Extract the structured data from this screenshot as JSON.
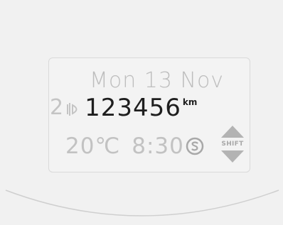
{
  "display": {
    "date": "Mon 13 Nov",
    "trip_gear": "2",
    "odometer": "123456",
    "odometer_unit": "km",
    "temperature": "20℃",
    "time": "8:30",
    "shift_label": "SHIFT"
  },
  "icons": {
    "lamp": "headlamp-icon",
    "sport_mode": "s-mode-icon",
    "shift_arrows": "shift-up-down-icon"
  },
  "colors": {
    "active_text": "#1e1e1e",
    "inactive_text": "#c2c2c2"
  }
}
